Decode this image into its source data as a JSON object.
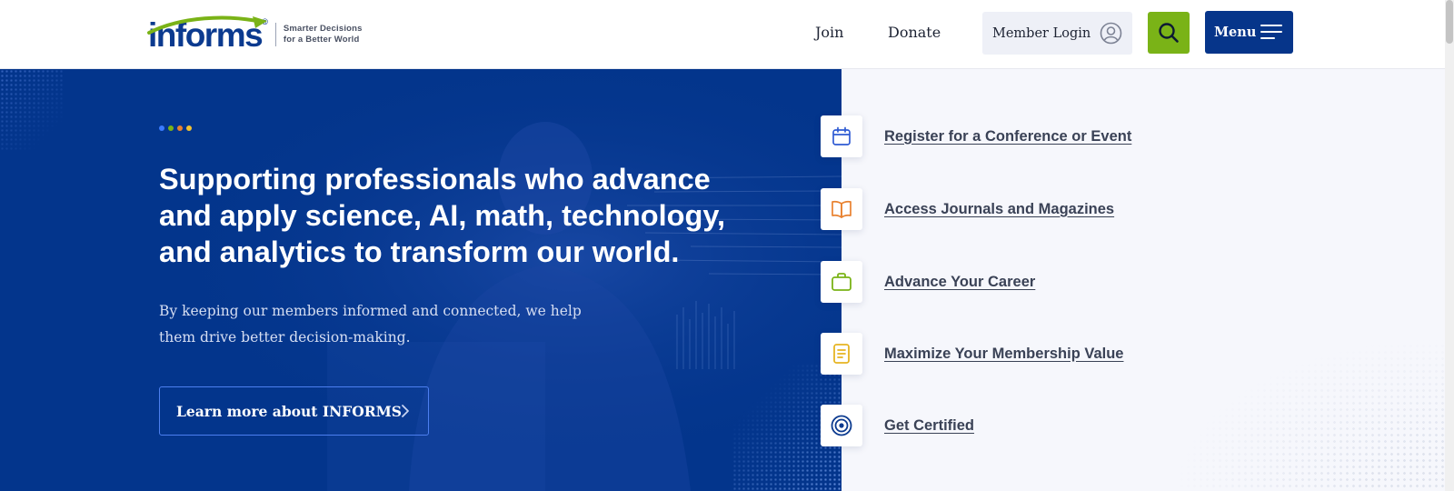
{
  "header": {
    "logo_text": "informs",
    "logo_mark": "®",
    "tagline_line1": "Smarter Decisions",
    "tagline_line2": "for a Better World",
    "nav": {
      "join": "Join",
      "donate": "Donate"
    },
    "member_login": "Member Login",
    "menu": "Menu"
  },
  "hero": {
    "title": "Supporting professionals who advance and apply science, AI, math, technology, and analytics to transform our world.",
    "subtitle": "By keeping our members informed and connected, we help them drive better decision-making.",
    "cta": "Learn more about INFORMS"
  },
  "quick_links": [
    {
      "label": "Register for a Conference or Event",
      "icon": "calendar-icon",
      "color": "#2f5bd3"
    },
    {
      "label": "Access Journals and Magazines",
      "icon": "book-open-icon",
      "color": "#e8812f"
    },
    {
      "label": "Advance Your Career",
      "icon": "briefcase-icon",
      "color": "#7ab317"
    },
    {
      "label": "Maximize Your Membership Value",
      "icon": "document-icon",
      "color": "#e6b422"
    },
    {
      "label": "Get Certified",
      "icon": "target-icon",
      "color": "#0b3a8f"
    }
  ],
  "colors": {
    "brand_navy": "#03358c",
    "accent_green": "#7ab317",
    "accent_dots": [
      "#3b7bff",
      "#7ab317",
      "#e8812f",
      "#f2c230"
    ]
  }
}
